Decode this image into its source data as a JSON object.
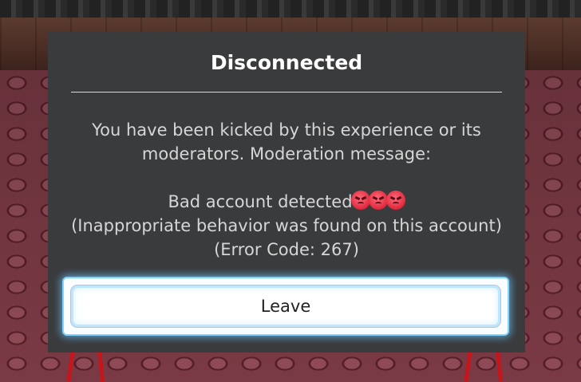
{
  "dialog": {
    "title": "Disconnected",
    "message_line1": "You have been kicked by this experience or its",
    "message_line2": "moderators. Moderation message:",
    "reason_text": "Bad account detected",
    "reason_emoji": [
      "angry-face-icon",
      "angry-face-icon",
      "angry-face-icon"
    ],
    "detail_line": "(Inappropriate behavior was found on this account)",
    "error_code": "(Error Code: 267)",
    "leave_label": "Leave"
  },
  "colors": {
    "dialog_background": "#3a3b3d",
    "button_glow": "#7fd3ff",
    "emoji_red": "#e0283c"
  }
}
